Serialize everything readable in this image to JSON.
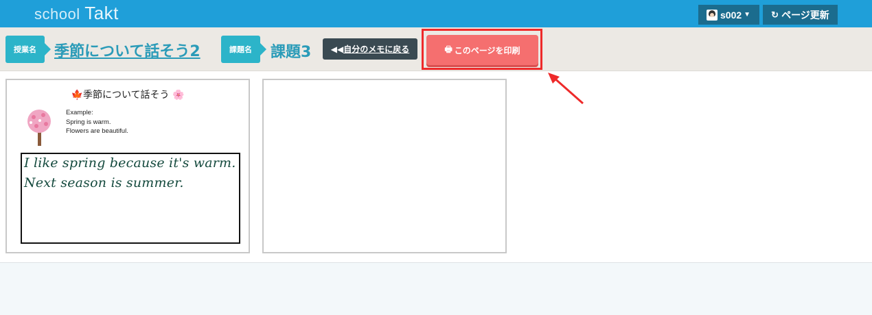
{
  "header": {
    "logo_school": "school",
    "logo_takt": "Takt",
    "user_label": "s002",
    "refresh_label": "ページ更新"
  },
  "subbar": {
    "lesson_tag": "授業名",
    "lesson_title": "季節について話そう2",
    "task_tag": "課題名",
    "task_title": "課題3",
    "back_label": "自分のメモに戻る",
    "print_label": "このページを印刷"
  },
  "worksheet": {
    "title": "季節について話そう",
    "example_lines": [
      "Example:",
      "Spring is warm.",
      "Flowers are beautiful."
    ],
    "handwriting_lines": [
      "I like spring because it's warm.",
      "Next season is summer."
    ]
  },
  "colors": {
    "topbar": "#1f9fd9",
    "accent": "#2cb4c9",
    "print_button": "#f56f6f",
    "highlight": "#ee2a2a"
  },
  "icons": [
    "user-avatar-icon",
    "chevron-down-icon",
    "refresh-icon",
    "back-icon",
    "print-icon",
    "maple-leaf-icon",
    "cherry-blossom-icon",
    "tree-icon"
  ]
}
